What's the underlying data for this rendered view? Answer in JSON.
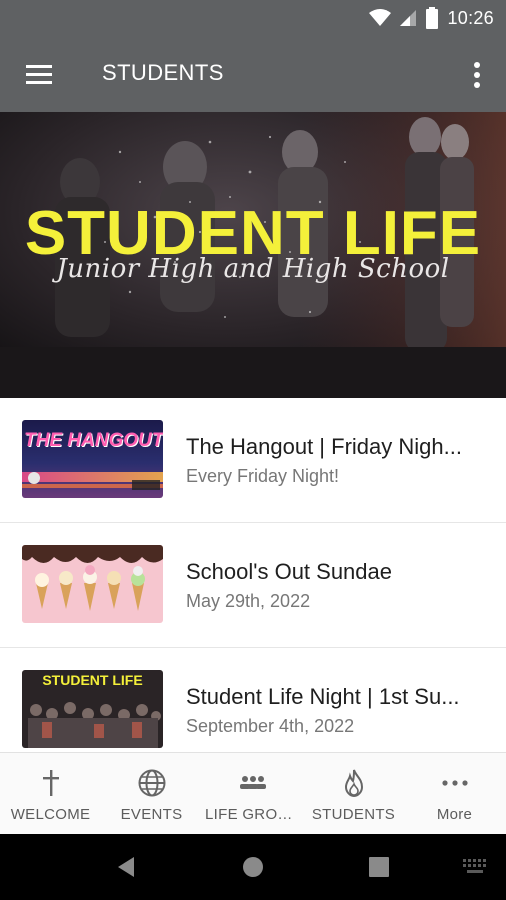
{
  "status_bar": {
    "time": "10:26"
  },
  "app_bar": {
    "title": "STUDENTS"
  },
  "hero": {
    "title": "STUDENT LIFE",
    "subtitle": "Junior High and High School"
  },
  "items": [
    {
      "title": "The Hangout | Friday Nigh...",
      "subtitle": "Every Friday Night!",
      "thumb_text": "THE HANGOUT"
    },
    {
      "title": "School's Out Sundae",
      "subtitle": "May 29th, 2022",
      "thumb_text": ""
    },
    {
      "title": "Student Life Night | 1st Su...",
      "subtitle": "September 4th, 2022",
      "thumb_text": "STUDENT LIFE"
    }
  ],
  "tabs": [
    {
      "label": "WELCOME",
      "icon": "cross-icon"
    },
    {
      "label": "EVENTS",
      "icon": "globe-icon"
    },
    {
      "label": "LIFE GROU...",
      "icon": "group-icon"
    },
    {
      "label": "STUDENTS",
      "icon": "flame-icon"
    },
    {
      "label": "More",
      "icon": "more-dots-icon"
    }
  ],
  "colors": {
    "app_bar": "#5f6163",
    "hero_title": "#f4f03a"
  }
}
